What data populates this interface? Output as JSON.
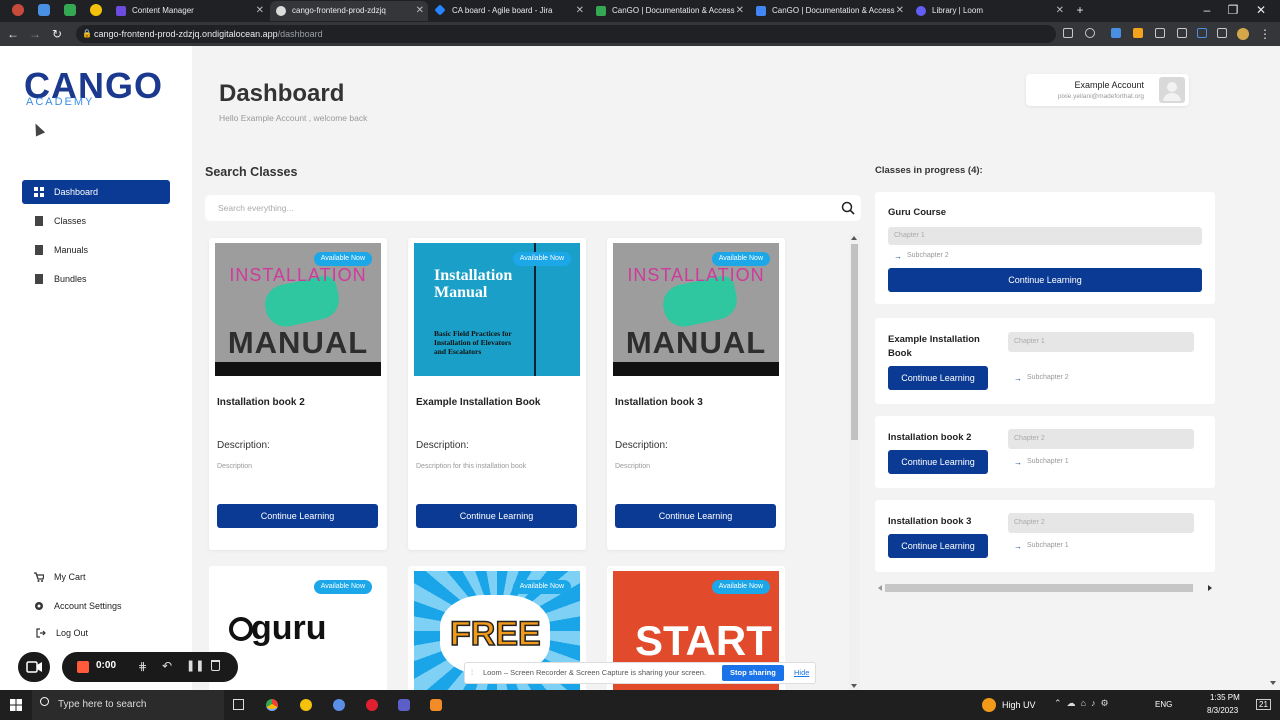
{
  "browser": {
    "tabs": [
      {
        "label": "Content Manager"
      },
      {
        "label": "cango-frontend-prod-zdzjq"
      },
      {
        "label": "CA board - Agile board - Jira"
      },
      {
        "label": "CanGO | Documentation & Access"
      },
      {
        "label": "CanGO | Documentation & Access"
      },
      {
        "label": "Library | Loom"
      }
    ],
    "url_host": "cango-frontend-prod-zdzjq.ondigitalocean.app",
    "url_path": "/dashboard"
  },
  "sidebar": {
    "logo_big": "CANGO",
    "logo_small": "ACADEMY",
    "nav": [
      {
        "label": "Dashboard"
      },
      {
        "label": "Classes"
      },
      {
        "label": "Manuals"
      },
      {
        "label": "Bundles"
      }
    ],
    "bottom": [
      {
        "label": "My Cart"
      },
      {
        "label": "Account Settings"
      },
      {
        "label": "Log Out"
      }
    ]
  },
  "header": {
    "title": "Dashboard",
    "welcome": "Hello Example Account , welcome back"
  },
  "account": {
    "name": "Example Account",
    "email": "pixie.yeilani@madeforthat.org"
  },
  "search": {
    "heading": "Search Classes",
    "placeholder": "Search everything..."
  },
  "cards": [
    {
      "badge": "Available Now",
      "title": "Installation book 2",
      "desc_label": "Description:",
      "desc": "Description",
      "button": "Continue Learning",
      "img_top": "INSTALLATION",
      "img_bottom": "MANUAL"
    },
    {
      "badge": "Available Now",
      "title": "Example Installation Book",
      "desc_label": "Description:",
      "desc": "Description for this installation book",
      "button": "Continue Learning",
      "img_title": "Installation Manual",
      "img_sub": "Basic Field Practices for Installation of Elevators and Escalators"
    },
    {
      "badge": "Available Now",
      "title": "Installation book 3",
      "desc_label": "Description:",
      "desc": "Description",
      "button": "Continue Learning",
      "img_top": "INSTALLATION",
      "img_bottom": "MANUAL"
    }
  ],
  "cards_row2": [
    {
      "badge": "Available Now",
      "img_text": "guru"
    },
    {
      "badge": "Available Now",
      "img_text": "FREE"
    },
    {
      "badge": "Available Now",
      "img_text": "START"
    }
  ],
  "progress": {
    "heading": "Classes in progress (4):",
    "items": [
      {
        "title": "Guru Course",
        "chapter": "Chapter 1",
        "sub": "Subchapter 2",
        "button": "Continue Learning"
      },
      {
        "title": "Example Installation Book",
        "chapter": "Chapter 1",
        "sub": "Subchapter 2",
        "button": "Continue Learning"
      },
      {
        "title": "Installation book 2",
        "chapter": "Chapter 2",
        "sub": "Subchapter 1",
        "button": "Continue Learning"
      },
      {
        "title": "Installation book 3",
        "chapter": "Chapter 2",
        "sub": "Subchapter 1",
        "button": "Continue Learning"
      }
    ]
  },
  "recorder": {
    "time": "0:00"
  },
  "loom": {
    "message": "Loom – Screen Recorder & Screen Capture is sharing your screen.",
    "stop": "Stop sharing",
    "hide": "Hide"
  },
  "taskbar": {
    "search_placeholder": "Type here to search",
    "weather": "High UV",
    "lang": "ENG",
    "time": "1:35 PM",
    "date": "8/3/2023",
    "notif": "21"
  },
  "colors": {
    "primary": "#0b3a94",
    "badge": "#1ba7e8",
    "recording": "#ff5b3a"
  }
}
